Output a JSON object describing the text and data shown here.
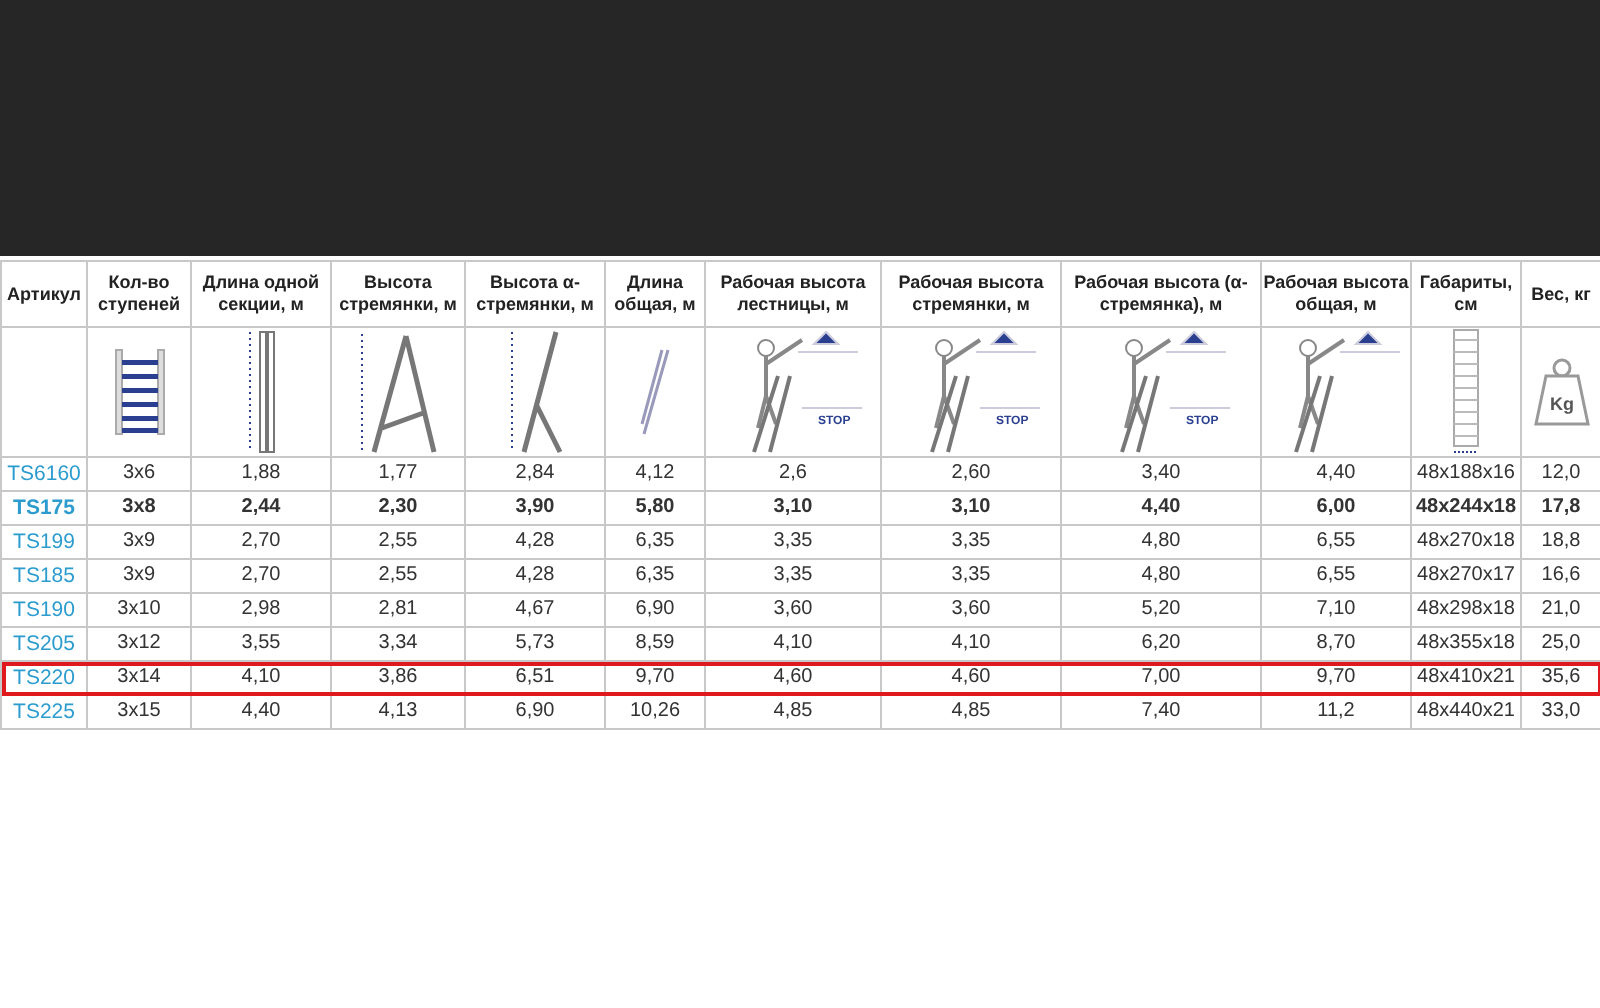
{
  "table": {
    "columns": [
      {
        "header": "Артикул"
      },
      {
        "header": "Кол-во ступеней"
      },
      {
        "header": "Длина одной секции, м"
      },
      {
        "header": "Высота стремянки, м"
      },
      {
        "header": "Высота α-стремянки, м"
      },
      {
        "header": "Длина общая, м"
      },
      {
        "header": "Рабочая высота лестницы, м",
        "icon_label": "STOP"
      },
      {
        "header": "Рабочая высота стремянки, м",
        "icon_label": "STOP"
      },
      {
        "header": "Рабочая высота (α-стремянка), м",
        "icon_label": "STOP"
      },
      {
        "header": "Рабочая высота общая, м"
      },
      {
        "header": "Габариты, см"
      },
      {
        "header": "Вес, кг",
        "icon_label": "Kg"
      }
    ],
    "rows": [
      {
        "bold": false,
        "highlighted": false,
        "cells": [
          "TS6160",
          "3x6",
          "1,88",
          "1,77",
          "2,84",
          "4,12",
          "2,6",
          "2,60",
          "3,40",
          "4,40",
          "48x188x16",
          "12,0"
        ]
      },
      {
        "bold": true,
        "highlighted": false,
        "cells": [
          "TS175",
          "3x8",
          "2,44",
          "2,30",
          "3,90",
          "5,80",
          "3,10",
          "3,10",
          "4,40",
          "6,00",
          "48x244x18",
          "17,8"
        ]
      },
      {
        "bold": false,
        "highlighted": false,
        "cells": [
          "TS199",
          "3x9",
          "2,70",
          "2,55",
          "4,28",
          "6,35",
          "3,35",
          "3,35",
          "4,80",
          "6,55",
          "48x270x18",
          "18,8"
        ]
      },
      {
        "bold": false,
        "highlighted": false,
        "cells": [
          "TS185",
          "3x9",
          "2,70",
          "2,55",
          "4,28",
          "6,35",
          "3,35",
          "3,35",
          "4,80",
          "6,55",
          "48x270x17",
          "16,6"
        ]
      },
      {
        "bold": false,
        "highlighted": false,
        "cells": [
          "TS190",
          "3x10",
          "2,98",
          "2,81",
          "4,67",
          "6,90",
          "3,60",
          "3,60",
          "5,20",
          "7,10",
          "48x298x18",
          "21,0"
        ]
      },
      {
        "bold": false,
        "highlighted": false,
        "cells": [
          "TS205",
          "3x12",
          "3,55",
          "3,34",
          "5,73",
          "8,59",
          "4,10",
          "4,10",
          "6,20",
          "8,70",
          "48x355x18",
          "25,0"
        ]
      },
      {
        "bold": false,
        "highlighted": true,
        "cells": [
          "TS220",
          "3x14",
          "4,10",
          "3,86",
          "6,51",
          "9,70",
          "4,60",
          "4,60",
          "7,00",
          "9,70",
          "48x410x21",
          "35,6"
        ]
      },
      {
        "bold": false,
        "highlighted": false,
        "cells": [
          "TS225",
          "3x15",
          "4,40",
          "4,13",
          "6,90",
          "10,26",
          "4,85",
          "4,85",
          "7,40",
          "11,2",
          "48x440x21",
          "33,0"
        ]
      }
    ]
  }
}
